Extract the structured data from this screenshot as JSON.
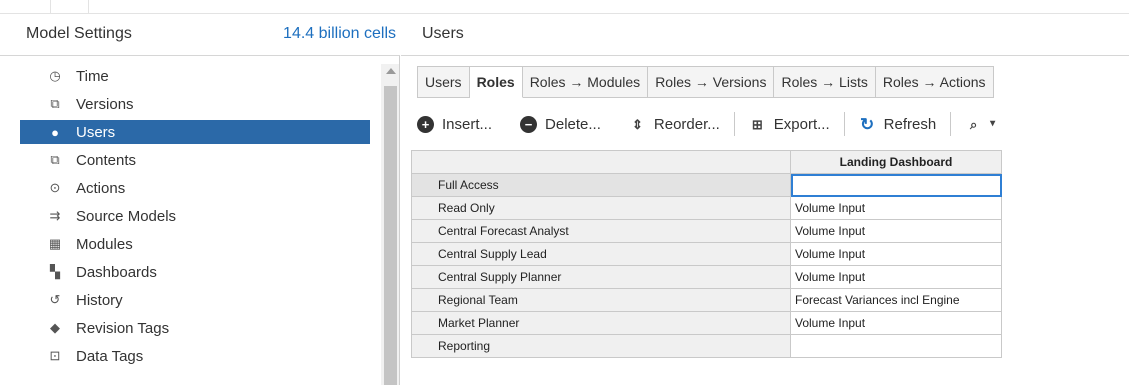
{
  "left_panel": {
    "title": "Model Settings",
    "cells": "14.4 billion cells",
    "items": [
      {
        "label": "Time",
        "icon": "clock-icon",
        "glyph": "◷",
        "selected": false
      },
      {
        "label": "Versions",
        "icon": "versions-icon",
        "glyph": "⧉",
        "selected": false
      },
      {
        "label": "Users",
        "icon": "user-icon",
        "glyph": "●",
        "selected": true
      },
      {
        "label": "Contents",
        "icon": "contents-icon",
        "glyph": "⧉",
        "selected": false
      },
      {
        "label": "Actions",
        "icon": "actions-icon",
        "glyph": "⊙",
        "selected": false
      },
      {
        "label": "Source Models",
        "icon": "source-models-icon",
        "glyph": "⇉",
        "selected": false
      },
      {
        "label": "Modules",
        "icon": "modules-icon",
        "glyph": "▦",
        "selected": false
      },
      {
        "label": "Dashboards",
        "icon": "dashboards-icon",
        "glyph": "▚",
        "selected": false
      },
      {
        "label": "History",
        "icon": "history-icon",
        "glyph": "↺",
        "selected": false
      },
      {
        "label": "Revision Tags",
        "icon": "tag-icon",
        "glyph": "◆",
        "selected": false
      },
      {
        "label": "Data Tags",
        "icon": "data-tags-icon",
        "glyph": "⊡",
        "selected": false
      }
    ],
    "selected_color": "#2b69a8",
    "cells_color": "#1d6fbf"
  },
  "right_panel": {
    "title": "Users",
    "tabs": [
      {
        "label": "Users",
        "active": false
      },
      {
        "label": "Roles",
        "active": true
      },
      {
        "label": "Roles → Modules",
        "active": false
      },
      {
        "label": "Roles → Versions",
        "active": false
      },
      {
        "label": "Roles → Lists",
        "active": false
      },
      {
        "label": "Roles → Actions",
        "active": false
      }
    ],
    "toolbar": {
      "insert": "Insert...",
      "delete": "Delete...",
      "reorder": "Reorder...",
      "export": "Export...",
      "refresh": "Refresh"
    },
    "grid": {
      "column_header": "Landing Dashboard",
      "rows": [
        {
          "role": "Full Access",
          "value": ""
        },
        {
          "role": "Read Only",
          "value": "Volume Input"
        },
        {
          "role": "Central Forecast Analyst",
          "value": "Volume Input"
        },
        {
          "role": "Central Supply Lead",
          "value": "Volume Input"
        },
        {
          "role": "Central Supply Planner",
          "value": "Volume Input"
        },
        {
          "role": "Regional Team",
          "value": "Forecast Variances incl Engine"
        },
        {
          "role": "Market Planner",
          "value": "Volume Input"
        },
        {
          "role": "Reporting",
          "value": ""
        }
      ]
    }
  }
}
